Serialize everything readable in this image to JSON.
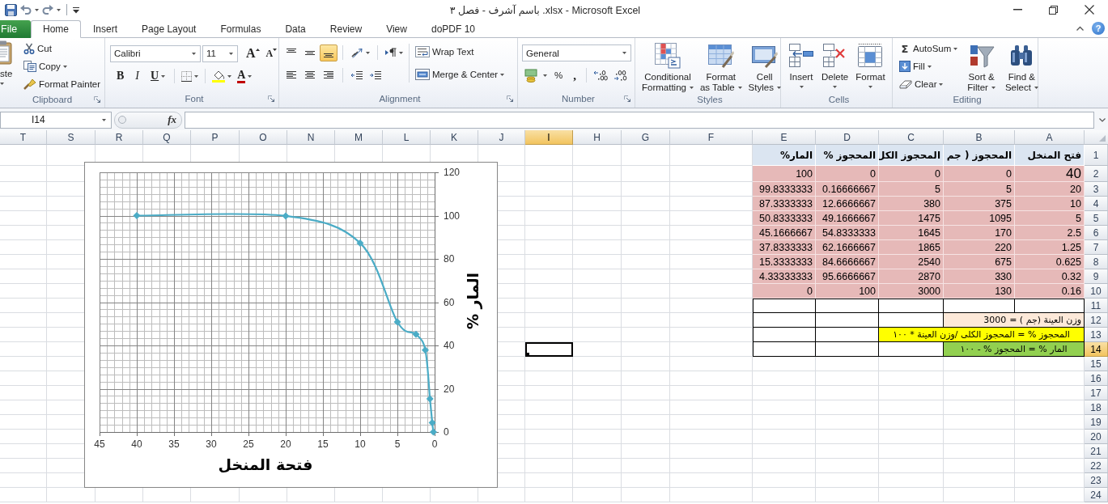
{
  "window": {
    "title": "باسم آشرف - فصل ٣ .xlsx - Microsoft Excel"
  },
  "tabs": [
    {
      "label": "File",
      "kind": "file",
      "selected": false
    },
    {
      "label": "Home",
      "kind": "tab",
      "selected": true
    },
    {
      "label": "Insert",
      "kind": "tab",
      "selected": false
    },
    {
      "label": "Page Layout",
      "kind": "tab",
      "selected": false
    },
    {
      "label": "Formulas",
      "kind": "tab",
      "selected": false
    },
    {
      "label": "Data",
      "kind": "tab",
      "selected": false
    },
    {
      "label": "Review",
      "kind": "tab",
      "selected": false
    },
    {
      "label": "View",
      "kind": "tab",
      "selected": false
    },
    {
      "label": "doPDF 10",
      "kind": "tab",
      "selected": false
    }
  ],
  "help": "?",
  "ribbon": {
    "clipboard": {
      "label": "Clipboard",
      "paste": "ste",
      "cut": "Cut",
      "copy": "Copy",
      "format_painter": "Format Painter"
    },
    "font": {
      "label": "Font",
      "font_name": "Calibri",
      "font_size": "11",
      "grow": "A",
      "shrink": "A",
      "bold": "B",
      "italic": "I",
      "underline": "U",
      "font_color": "A"
    },
    "alignment": {
      "label": "Alignment",
      "vertical": [
        {
          "kind": "top",
          "selected": false
        },
        {
          "kind": "middle",
          "selected": false
        },
        {
          "kind": "bottom",
          "selected": true
        }
      ],
      "horizontal": [
        {
          "kind": "left",
          "selected": false
        },
        {
          "kind": "center",
          "selected": false
        },
        {
          "kind": "right",
          "selected": false
        }
      ],
      "wrap_text": "Wrap Text",
      "merge_center": "Merge & Center"
    },
    "number": {
      "label": "Number",
      "format": "General",
      "percent": "%",
      "comma": ","
    },
    "styles": {
      "label": "Styles",
      "buttons": [
        {
          "kind": "conditional",
          "label": "Conditional\nFormatting"
        },
        {
          "kind": "table",
          "label": "Format\nas Table"
        },
        {
          "kind": "cell",
          "label": "Cell\nStyles"
        }
      ]
    },
    "cells": {
      "label": "Cells",
      "buttons": [
        {
          "kind": "insert",
          "label": "Insert"
        },
        {
          "kind": "delete",
          "label": "Delete"
        },
        {
          "kind": "format",
          "label": "Format"
        }
      ]
    },
    "editing": {
      "label": "Editing",
      "autosum_symbol": "Σ",
      "autosum": "AutoSum",
      "fill": "Fill",
      "clear": "Clear",
      "buttons": [
        {
          "kind": "sort",
          "label": "Sort &\nFilter"
        },
        {
          "kind": "find",
          "label": "Find &\nSelect"
        }
      ]
    }
  },
  "formula_bar": {
    "name_box": "I14",
    "fx": "fx"
  },
  "sheet": {
    "columns": [
      {
        "label": "T",
        "selected": false
      },
      {
        "label": "S",
        "selected": false
      },
      {
        "label": "R",
        "selected": false
      },
      {
        "label": "Q",
        "selected": false
      },
      {
        "label": "P",
        "selected": false
      },
      {
        "label": "O",
        "selected": false
      },
      {
        "label": "N",
        "selected": false
      },
      {
        "label": "M",
        "selected": false
      },
      {
        "label": "L",
        "selected": false
      },
      {
        "label": "K",
        "selected": false
      },
      {
        "label": "J",
        "selected": false
      },
      {
        "label": "I",
        "selected": true
      },
      {
        "label": "H",
        "selected": false
      },
      {
        "label": "G",
        "selected": false
      },
      {
        "label": "F",
        "selected": false
      },
      {
        "label": "E",
        "selected": false
      },
      {
        "label": "D",
        "selected": false
      },
      {
        "label": "C",
        "selected": false
      },
      {
        "label": "B",
        "selected": false
      },
      {
        "label": "A",
        "selected": false
      }
    ],
    "rows": [
      {
        "label": "1",
        "selected": false
      },
      {
        "label": "2",
        "selected": false
      },
      {
        "label": "3",
        "selected": false
      },
      {
        "label": "4",
        "selected": false
      },
      {
        "label": "5",
        "selected": false
      },
      {
        "label": "6",
        "selected": false
      },
      {
        "label": "7",
        "selected": false
      },
      {
        "label": "8",
        "selected": false
      },
      {
        "label": "9",
        "selected": false
      },
      {
        "label": "10",
        "selected": false
      },
      {
        "label": "11",
        "selected": false
      },
      {
        "label": "12",
        "selected": false
      },
      {
        "label": "13",
        "selected": false
      },
      {
        "label": "14",
        "selected": true
      },
      {
        "label": "15",
        "selected": false
      },
      {
        "label": "16",
        "selected": false
      },
      {
        "label": "17",
        "selected": false
      },
      {
        "label": "18",
        "selected": false
      },
      {
        "label": "19",
        "selected": false
      },
      {
        "label": "20",
        "selected": false
      },
      {
        "label": "21",
        "selected": false
      },
      {
        "label": "22",
        "selected": false
      },
      {
        "label": "23",
        "selected": false
      },
      {
        "label": "24",
        "selected": false
      }
    ],
    "table": {
      "columns": [
        {
          "header": "فتح المنخل",
          "values": [
            "40",
            "20",
            "10",
            "5",
            "2.5",
            "1.25",
            "0.625",
            "0.32",
            "0.16"
          ]
        },
        {
          "header": "المحجوز ( جم",
          "values": [
            "0",
            "5",
            "375",
            "1095",
            "170",
            "220",
            "675",
            "330",
            "130"
          ]
        },
        {
          "header": "المحجوز الكل",
          "values": [
            "0",
            "5",
            "380",
            "1475",
            "1645",
            "1865",
            "2540",
            "2870",
            "3000"
          ]
        },
        {
          "header": "المحجوز %",
          "values": [
            "0",
            "0.16666667",
            "12.6666667",
            "49.1666667",
            "54.8333333",
            "62.1666667",
            "84.6666667",
            "95.6666667",
            "100"
          ]
        },
        {
          "header": "المار%",
          "values": [
            "100",
            "99.8333333",
            "87.3333333",
            "50.8333333",
            "45.1666667",
            "37.8333333",
            "15.3333333",
            "4.33333333",
            "0"
          ]
        }
      ]
    },
    "notes": [
      {
        "kind": "value",
        "value": "3000",
        "label": "وزن العينة (جم ) =",
        "color": "#fde9d9"
      },
      {
        "kind": "wide",
        "text": "المحجوز % = المحجوز الكلى /وزن العينة * ١٠٠",
        "color": "#ffff00"
      },
      {
        "kind": "narrow",
        "text": "المار % = المحجوز % - ١٠٠",
        "color": "#92d050"
      }
    ],
    "chart": {
      "chart_data": {
        "type": "line",
        "xlabel": "فتحة المنخل",
        "ylabel": "المار %",
        "x": [
          40,
          20,
          10,
          5,
          2.5,
          1.25,
          0.625,
          0.32,
          0.16
        ],
        "series": [
          {
            "color": "#4bacc6",
            "marker": "diamond",
            "values": [
              100,
              99.8333333,
              87.3333333,
              50.8333333,
              45.1666667,
              37.8333333,
              15.3333333,
              4.33333333,
              0
            ]
          }
        ],
        "xlim": [
          45,
          0
        ],
        "ylim": [
          0,
          120
        ],
        "xticks": [
          45,
          40,
          35,
          30,
          25,
          20,
          15,
          10,
          5,
          0
        ],
        "yticks": [
          0,
          20,
          40,
          60,
          80,
          100,
          120
        ],
        "grid": true
      }
    }
  }
}
